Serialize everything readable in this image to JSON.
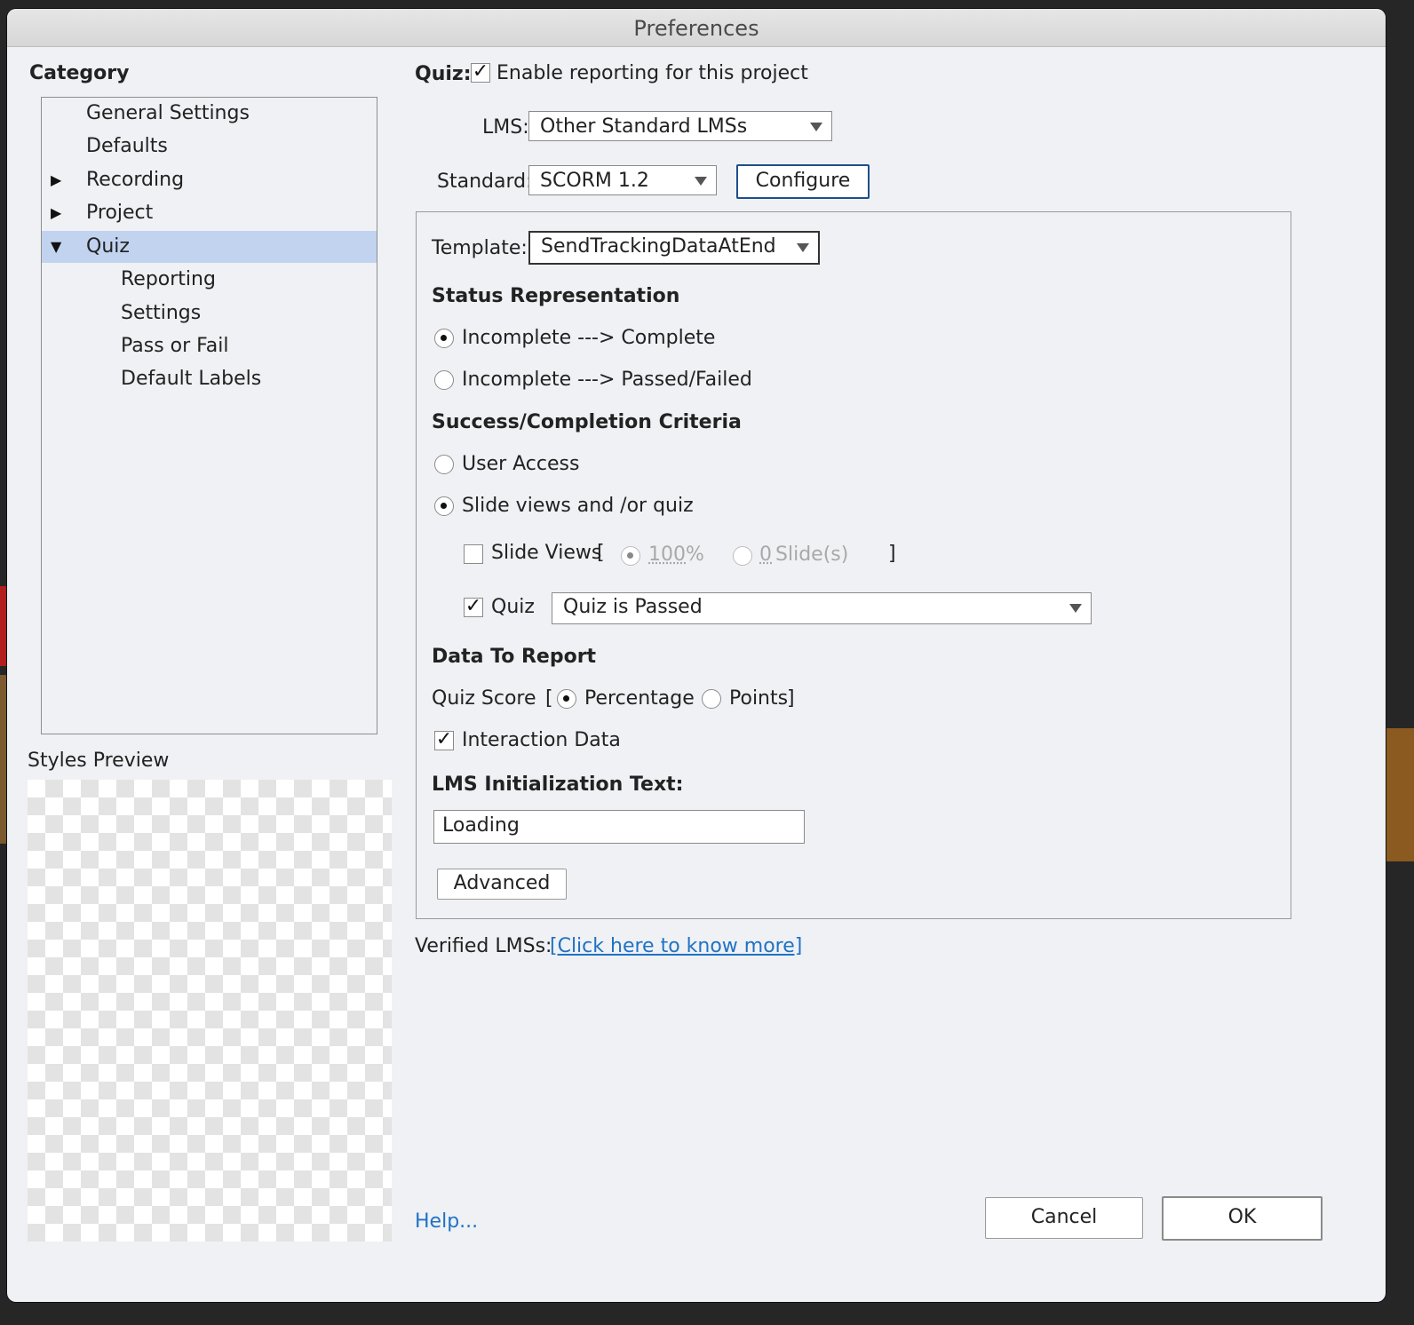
{
  "window": {
    "title": "Preferences"
  },
  "category": {
    "heading": "Category",
    "items": [
      {
        "label": "General Settings",
        "arrow": ""
      },
      {
        "label": "Defaults",
        "arrow": ""
      },
      {
        "label": "Recording",
        "arrow": "▶"
      },
      {
        "label": "Project",
        "arrow": "▶"
      },
      {
        "label": "Quiz",
        "arrow": "▼",
        "selected": true
      },
      {
        "label": "Reporting",
        "arrow": ""
      },
      {
        "label": "Settings",
        "arrow": ""
      },
      {
        "label": "Pass or Fail",
        "arrow": ""
      },
      {
        "label": "Default Labels",
        "arrow": ""
      }
    ]
  },
  "styles_preview": {
    "label": "Styles Preview"
  },
  "quiz": {
    "label": "Quiz:",
    "enable_reporting": {
      "label": "Enable reporting for this project",
      "checked": true,
      "mark": "✓"
    }
  },
  "lms": {
    "label": "LMS:",
    "value": "Other Standard LMSs"
  },
  "standard": {
    "label": "Standard:",
    "value": "SCORM 1.2",
    "configure_label": "Configure"
  },
  "template": {
    "label": "Template:",
    "value": "SendTrackingDataAtEnd"
  },
  "status": {
    "heading": "Status Representation",
    "options": [
      {
        "label": "Incomplete ---> Complete",
        "selected": true
      },
      {
        "label": "Incomplete ---> Passed/Failed",
        "selected": false
      }
    ]
  },
  "criteria": {
    "heading": "Success/Completion Criteria",
    "user_access": {
      "label": "User Access",
      "selected": false
    },
    "slide_views_quiz": {
      "label": "Slide views and /or quiz",
      "selected": true
    },
    "slide_views": {
      "label": "Slide Views",
      "checked": false,
      "open_bracket": "[",
      "close_bracket": "]",
      "percent": {
        "value": "100",
        "unit": "%",
        "selected": true
      },
      "slides": {
        "value": "0",
        "unit": "Slide(s)",
        "selected": false
      }
    },
    "quiz": {
      "label": "Quiz",
      "checked": true,
      "mark": "✓",
      "value": "Quiz is Passed"
    }
  },
  "data_to_report": {
    "heading": "Data To Report",
    "quiz_score_label": "Quiz Score",
    "open_bracket": "[",
    "close_bracket": "]",
    "percentage": {
      "label": "Percentage",
      "selected": true
    },
    "points": {
      "label": "Points",
      "selected": false
    },
    "interaction_data": {
      "label": "Interaction Data",
      "checked": true,
      "mark": "✓"
    }
  },
  "lms_init": {
    "label": "LMS Initialization Text:",
    "value": "Loading"
  },
  "advanced_label": "Advanced",
  "verified": {
    "label": "Verified LMSs:",
    "link": "[Click here to know more]"
  },
  "help_label": "Help...",
  "cancel_label": "Cancel",
  "ok_label": "OK"
}
